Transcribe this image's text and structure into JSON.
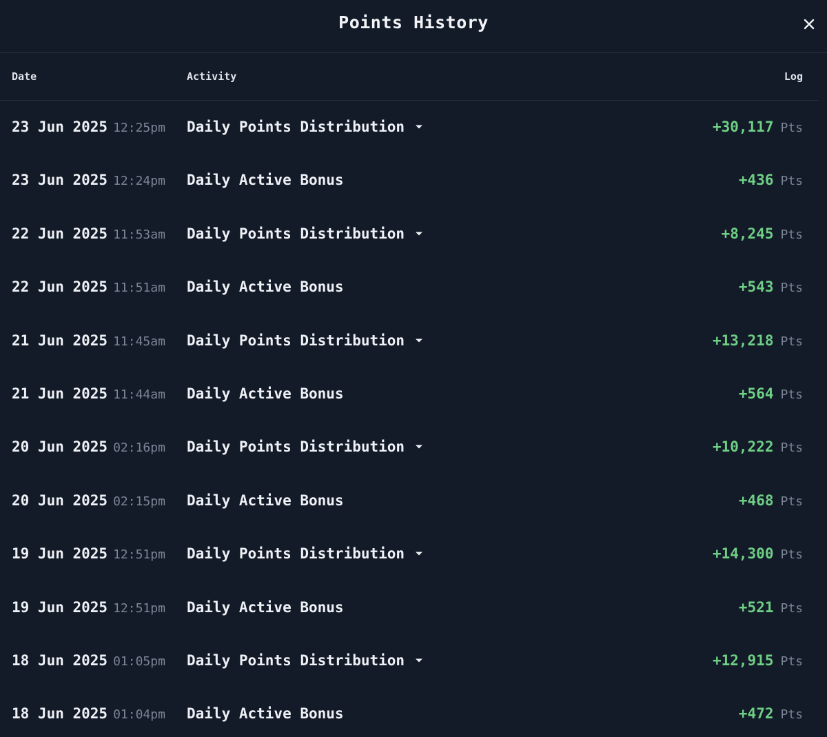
{
  "modal": {
    "title": "Points History",
    "close_icon": "close-icon"
  },
  "table": {
    "headers": {
      "date": "Date",
      "activity": "Activity",
      "log": "Log"
    },
    "rows": [
      {
        "date": "23 Jun 2025",
        "time": "12:25pm",
        "activity": "Daily Points Distribution",
        "expandable": true,
        "amount": "+30,117",
        "unit": "Pts"
      },
      {
        "date": "23 Jun 2025",
        "time": "12:24pm",
        "activity": "Daily Active Bonus",
        "expandable": false,
        "amount": "+436",
        "unit": "Pts"
      },
      {
        "date": "22 Jun 2025",
        "time": "11:53am",
        "activity": "Daily Points Distribution",
        "expandable": true,
        "amount": "+8,245",
        "unit": "Pts"
      },
      {
        "date": "22 Jun 2025",
        "time": "11:51am",
        "activity": "Daily Active Bonus",
        "expandable": false,
        "amount": "+543",
        "unit": "Pts"
      },
      {
        "date": "21 Jun 2025",
        "time": "11:45am",
        "activity": "Daily Points Distribution",
        "expandable": true,
        "amount": "+13,218",
        "unit": "Pts"
      },
      {
        "date": "21 Jun 2025",
        "time": "11:44am",
        "activity": "Daily Active Bonus",
        "expandable": false,
        "amount": "+564",
        "unit": "Pts"
      },
      {
        "date": "20 Jun 2025",
        "time": "02:16pm",
        "activity": "Daily Points Distribution",
        "expandable": true,
        "amount": "+10,222",
        "unit": "Pts"
      },
      {
        "date": "20 Jun 2025",
        "time": "02:15pm",
        "activity": "Daily Active Bonus",
        "expandable": false,
        "amount": "+468",
        "unit": "Pts"
      },
      {
        "date": "19 Jun 2025",
        "time": "12:51pm",
        "activity": "Daily Points Distribution",
        "expandable": true,
        "amount": "+14,300",
        "unit": "Pts"
      },
      {
        "date": "19 Jun 2025",
        "time": "12:51pm",
        "activity": "Daily Active Bonus",
        "expandable": false,
        "amount": "+521",
        "unit": "Pts"
      },
      {
        "date": "18 Jun 2025",
        "time": "01:05pm",
        "activity": "Daily Points Distribution",
        "expandable": true,
        "amount": "+12,915",
        "unit": "Pts"
      },
      {
        "date": "18 Jun 2025",
        "time": "01:04pm",
        "activity": "Daily Active Bonus",
        "expandable": false,
        "amount": "+472",
        "unit": "Pts"
      }
    ]
  },
  "colors": {
    "background": "#131a28",
    "positive_amount": "#6ecf85",
    "muted_text": "#7c8596",
    "divider": "#262e3d"
  }
}
